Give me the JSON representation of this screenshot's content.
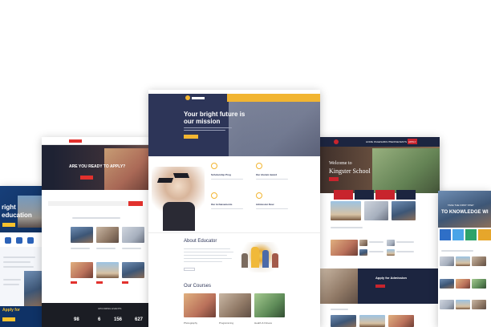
{
  "center": {
    "hero_title": "Your bright future is our mission",
    "about_title": "About Educator",
    "courses_title": "Our Courses",
    "features": [
      "Scholarship Prog",
      "Our Alumni Award",
      "Our Achievements",
      "Admission Now"
    ],
    "course_captions": [
      "Photography",
      "Programming",
      "Health & Fitness"
    ],
    "colors": {
      "hero": "#2d3558",
      "accent": "#f2b531"
    }
  },
  "left": {
    "hero_title": "ARE YOU READY TO APPLY?",
    "band_title": "UPCOMING EVENTS",
    "stats": [
      "98",
      "6",
      "156",
      "627"
    ],
    "colors": {
      "topbar": "#1e2233",
      "accent": "#e2312d"
    }
  },
  "far_left": {
    "hero_title_1": "right",
    "hero_title_2": "education",
    "promo_title": "Apply for",
    "colors": {
      "hero": "#143a73",
      "accent": "#f6c12c"
    }
  },
  "right": {
    "hero_title_1": "Welcome to",
    "hero_title_2": "Kingster School",
    "nav_labels": [
      "HOME",
      "PAGES",
      "ABOUT",
      "NEWS",
      "EVENTS",
      "CONTACT"
    ],
    "cta_label": "APPLY",
    "apply_title": "Apply for Admission",
    "colors": {
      "navy": "#1c2540",
      "red": "#c8242d"
    }
  },
  "far_right": {
    "hero_line_1": "TAKE THE FIRST STEP",
    "hero_line_2": "TO KNOWLEDGE WI",
    "tile_colors": [
      "#2f6fc7",
      "#4aa5e8",
      "#2da36a",
      "#e6a62b"
    ]
  }
}
